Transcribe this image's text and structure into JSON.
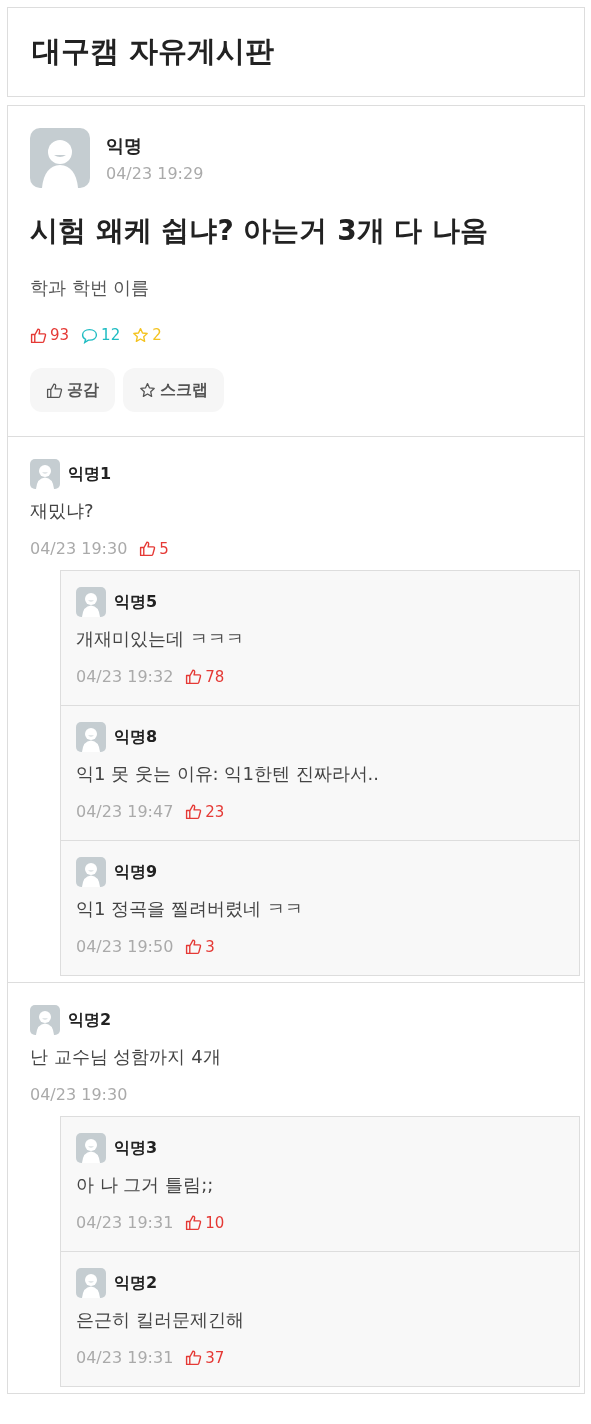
{
  "board": {
    "title": "대구캠 자유게시판"
  },
  "post": {
    "author": "익명",
    "time": "04/23 19:29",
    "title": "시험 왜케 쉽냐? 아는거 3개 다 나옴",
    "body": "학과 학번 이름",
    "likes": "93",
    "comments": "12",
    "scraps": "2",
    "buttons": [
      {
        "kind": "like",
        "label": "공감"
      },
      {
        "kind": "scrap",
        "label": "스크랩"
      }
    ]
  },
  "comments": [
    {
      "author": "익명1",
      "text": "재밌냐?",
      "time": "04/23 19:30",
      "likes": "5",
      "replies": [
        {
          "author": "익명5",
          "text": "개재미있는데 ㅋㅋㅋ",
          "time": "04/23 19:32",
          "likes": "78"
        },
        {
          "author": "익명8",
          "text": "익1 못 웃는 이유: 익1한텐 진짜라서..",
          "time": "04/23 19:47",
          "likes": "23"
        },
        {
          "author": "익명9",
          "text": "익1 정곡을 찔려버렸네 ㅋㅋ",
          "time": "04/23 19:50",
          "likes": "3"
        }
      ]
    },
    {
      "author": "익명2",
      "text": "난 교수님 성함까지 4개",
      "time": "04/23 19:30",
      "replies": [
        {
          "author": "익명3",
          "text": "아 나 그거 틀림;;",
          "time": "04/23 19:31",
          "likes": "10"
        },
        {
          "author": "익명2",
          "text": "은근히 킬러문제긴해",
          "time": "04/23 19:31",
          "likes": "37"
        }
      ]
    }
  ]
}
